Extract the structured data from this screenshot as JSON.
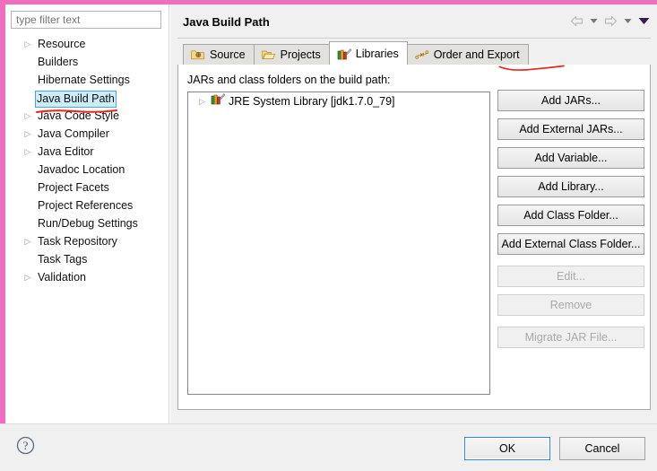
{
  "window": {
    "chrome_color": "#f06ec0",
    "annotation_color": "#e8251f"
  },
  "sidebar": {
    "filter": {
      "value": "",
      "placeholder": "type filter text"
    },
    "items": [
      {
        "label": "Resource",
        "expandable": true,
        "selected": false
      },
      {
        "label": "Builders",
        "expandable": false,
        "selected": false
      },
      {
        "label": "Hibernate Settings",
        "expandable": false,
        "selected": false
      },
      {
        "label": "Java Build Path",
        "expandable": false,
        "selected": true
      },
      {
        "label": "Java Code Style",
        "expandable": true,
        "selected": false
      },
      {
        "label": "Java Compiler",
        "expandable": true,
        "selected": false
      },
      {
        "label": "Java Editor",
        "expandable": true,
        "selected": false
      },
      {
        "label": "Javadoc Location",
        "expandable": false,
        "selected": false
      },
      {
        "label": "Project Facets",
        "expandable": false,
        "selected": false
      },
      {
        "label": "Project References",
        "expandable": false,
        "selected": false
      },
      {
        "label": "Run/Debug Settings",
        "expandable": false,
        "selected": false
      },
      {
        "label": "Task Repository",
        "expandable": true,
        "selected": false
      },
      {
        "label": "Task Tags",
        "expandable": false,
        "selected": false
      },
      {
        "label": "Validation",
        "expandable": true,
        "selected": false
      }
    ]
  },
  "header": {
    "title": "Java Build Path",
    "nav": {
      "back_icon": "arrow-left-icon",
      "back_menu_icon": "chevron-down-icon",
      "forward_icon": "arrow-right-icon",
      "forward_menu_icon": "chevron-down-icon",
      "menu_icon": "chevron-down-filled-icon"
    }
  },
  "tabs": [
    {
      "label": "Source",
      "icon": "source-folder-icon",
      "active": false
    },
    {
      "label": "Projects",
      "icon": "open-folder-icon",
      "active": false
    },
    {
      "label": "Libraries",
      "icon": "books-icon",
      "active": true
    },
    {
      "label": "Order and Export",
      "icon": "order-export-icon",
      "active": false
    }
  ],
  "main": {
    "list_label": "JARs and class folders on the build path:",
    "entries": [
      {
        "label": "JRE System Library [jdk1.7.0_79]",
        "icon": "books-icon",
        "expandable": true
      }
    ],
    "buttons": [
      {
        "label": "Add JARs...",
        "enabled": true
      },
      {
        "label": "Add External JARs...",
        "enabled": true
      },
      {
        "label": "Add Variable...",
        "enabled": true
      },
      {
        "label": "Add Library...",
        "enabled": true
      },
      {
        "label": "Add Class Folder...",
        "enabled": true
      },
      {
        "label": "Add External Class Folder...",
        "enabled": true
      },
      {
        "label": "Edit...",
        "enabled": false
      },
      {
        "label": "Remove",
        "enabled": false
      },
      {
        "label": "Migrate JAR File...",
        "enabled": false
      }
    ]
  },
  "footer": {
    "help_icon": "help-question-icon",
    "ok_label": "OK",
    "cancel_label": "Cancel"
  }
}
